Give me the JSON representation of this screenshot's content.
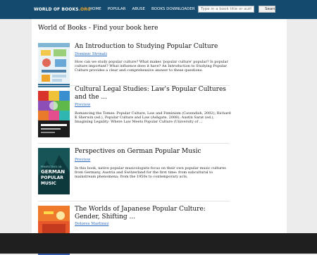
{
  "header": {
    "logo_main": "WORLD OF BOOKS",
    "logo_suffix": ".ORG",
    "nav": [
      "HOME",
      "POPULAR",
      "ABUSE",
      "BOOKS DOWNLOADER"
    ],
    "search_placeholder": "Type in a book title or author",
    "search_button": "Search"
  },
  "page_title": "World of Books - Find your book here",
  "books": [
    {
      "title": "An Introduction to Studying Popular Culture",
      "author": "Dominic Strinati",
      "description": "How can we study popular culture? What makes 'popular culture' popular? Is popular culture important? What influence does it have? An Introduction to Studying Popular Culture provides a clear and comprehensive answer to these questions."
    },
    {
      "title": "Cultural Legal Studies: Law's Popular Cultures and the ...",
      "author": "Preview",
      "description": "Romancing the Tomes: Popular Culture, Law and Feminism (Cavendish, 2002); Richard K Sherwin (ed.), Popular Culture and Law (Ashgate, 2008); Austin Sarat (ed.), Imagining Legality: Where Law Meets Popular Culture (University of ..."
    },
    {
      "title": "Perspectives on German Popular Music",
      "author": "Preview",
      "description": "In this book, native popular musicologists focus on their own popular music cultures from Germany, Austria and Switzerland for the first time: from subcultural to mainstream phenomena; from the 1950s to contemporary acts."
    },
    {
      "title": "The Worlds of Japanese Popular Culture: Gender, Shifting ...",
      "author": "Dolores Martinez",
      "description": ""
    }
  ],
  "covers": {
    "book3_lines": [
      "PERSPECTIVES ON",
      "GERMAN",
      "POPULAR",
      "MUSIC"
    ]
  },
  "colors": {
    "header_bg": "#134a6e",
    "logo_accent": "#f0a52a",
    "link": "#2a6bbd"
  }
}
